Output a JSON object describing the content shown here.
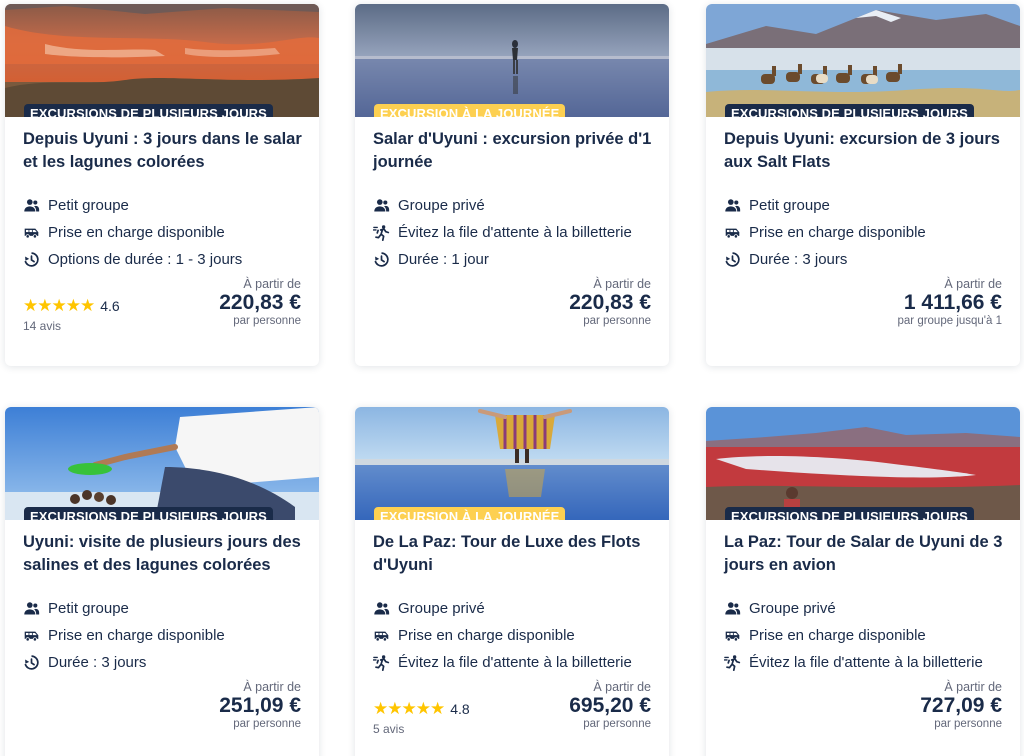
{
  "cards": [
    {
      "badge": "Excursions de plusieurs jours",
      "title": "Depuis Uyuni : 3 jours dans le salar et les lagunes colorées",
      "features": [
        "Petit groupe",
        "Prise en charge disponible",
        "Options de durée : 1 - 3 jours"
      ],
      "icons": [
        "group-icon",
        "shuttle-icon",
        "clock-icon"
      ],
      "rating": "4.6",
      "reviews": "14 avis",
      "price_from": "À partir de",
      "price": "220,83 €",
      "price_unit": "par personne"
    },
    {
      "badge": "Excursion à la journée",
      "title": "Salar d'Uyuni : excursion privée d'1 journée",
      "features": [
        "Groupe privé",
        "Évitez la file d'attente à la billetterie",
        "Durée : 1 jour"
      ],
      "icons": [
        "group-icon",
        "skip-line-icon",
        "clock-icon"
      ],
      "price_from": "À partir de",
      "price": "220,83 €",
      "price_unit": "par personne"
    },
    {
      "badge": "Excursions de plusieurs jours",
      "title": "Depuis Uyuni: excursion de 3 jours aux Salt Flats",
      "features": [
        "Petit groupe",
        "Prise en charge disponible",
        "Durée : 3 jours"
      ],
      "icons": [
        "group-icon",
        "shuttle-icon",
        "clock-icon"
      ],
      "price_from": "À partir de",
      "price": "1 411,66 €",
      "price_unit": "par groupe jusqu'à 1"
    },
    {
      "badge": "Excursions de plusieurs jours",
      "title": "Uyuni: visite de plusieurs jours des salines et des lagunes colorées",
      "features": [
        "Petit groupe",
        "Prise en charge disponible",
        "Durée : 3 jours"
      ],
      "icons": [
        "group-icon",
        "shuttle-icon",
        "clock-icon"
      ],
      "price_from": "À partir de",
      "price": "251,09 €",
      "price_unit": "par personne"
    },
    {
      "badge": "Excursion à la journée",
      "title": "De La Paz: Tour de Luxe des Flots d'Uyuni",
      "features": [
        "Groupe privé",
        "Prise en charge disponible",
        "Évitez la file d'attente à la billetterie"
      ],
      "icons": [
        "group-icon",
        "shuttle-icon",
        "skip-line-icon"
      ],
      "rating": "4.8",
      "reviews": "5 avis",
      "price_from": "À partir de",
      "price": "695,20 €",
      "price_unit": "par personne"
    },
    {
      "badge": "Excursions de plusieurs jours",
      "title": "La Paz: Tour de Salar de Uyuni de 3 jours en avion",
      "features": [
        "Groupe privé",
        "Prise en charge disponible",
        "Évitez la file d'attente à la billetterie"
      ],
      "icons": [
        "group-icon",
        "shuttle-icon",
        "skip-line-icon"
      ],
      "price_from": "À partir de",
      "price": "727,09 €",
      "price_unit": "par personne"
    }
  ],
  "colors": {
    "navy": "#1a2b49",
    "day_badge": "#fdd051",
    "star": "#ffc500",
    "muted": "#63687a"
  }
}
